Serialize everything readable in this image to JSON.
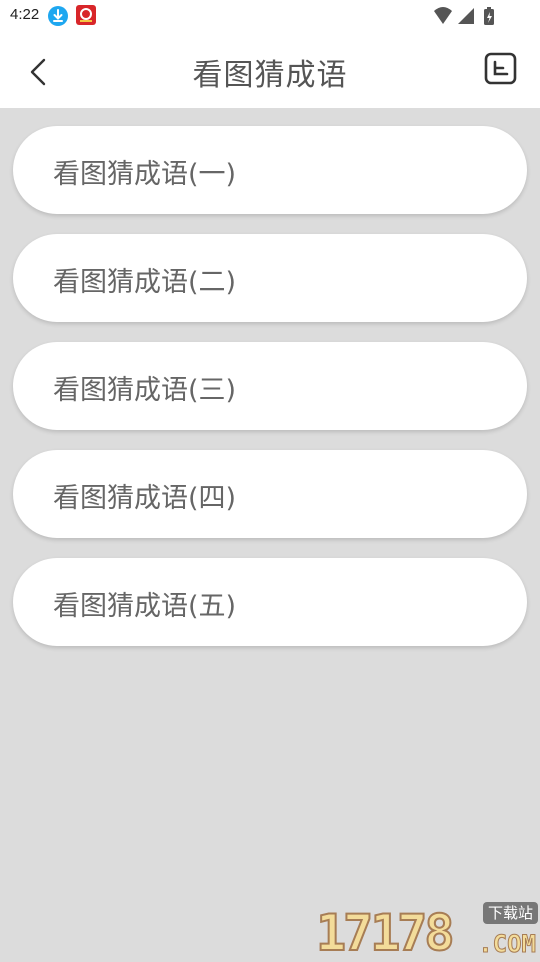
{
  "status_bar": {
    "time": "4:22",
    "icons": [
      "download-notification-icon",
      "app-notification-icon",
      "wifi-icon",
      "signal-icon",
      "battery-charging-icon"
    ]
  },
  "header": {
    "title": "看图猜成语",
    "back_icon": "chevron-left-icon",
    "menu_icon": "document-list-icon"
  },
  "items": [
    {
      "label": "看图猜成语(一)"
    },
    {
      "label": "看图猜成语(二)"
    },
    {
      "label": "看图猜成语(三)"
    },
    {
      "label": "看图猜成语(四)"
    },
    {
      "label": "看图猜成语(五)"
    }
  ],
  "watermark": {
    "number": "17178",
    "badge": "下载站",
    "suffix": ".COM"
  },
  "colors": {
    "background": "#dcdcdc",
    "card": "#ffffff",
    "text": "#666666",
    "title": "#555555"
  }
}
